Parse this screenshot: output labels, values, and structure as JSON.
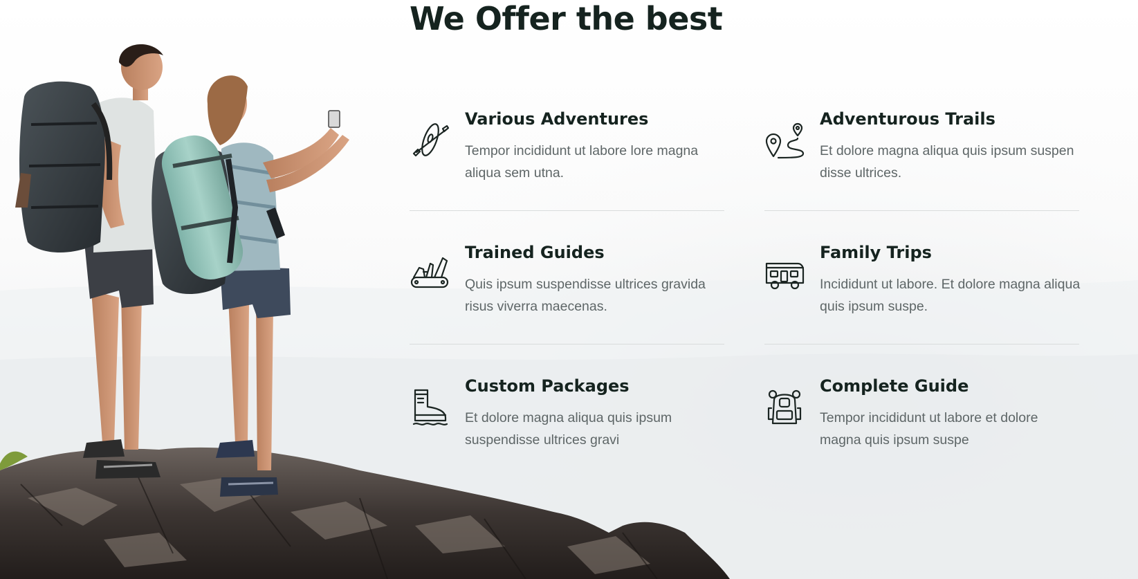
{
  "section": {
    "heading": "We Offer the best"
  },
  "features": [
    {
      "title": "Various Adventures",
      "description": "Tempor incididunt ut labore lore magna aliqua sem utna.",
      "icon": "kayak-icon"
    },
    {
      "title": "Adventurous Trails",
      "description": "Et dolore magna aliqua quis ipsum suspen disse ultrices.",
      "icon": "trail-route-icon"
    },
    {
      "title": "Trained Guides",
      "description": "Quis ipsum suspendisse ultrices gravida risus viverra maecenas.",
      "icon": "multitool-knife-icon"
    },
    {
      "title": "Family Trips",
      "description": "Incididunt ut labore. Et dolore magna aliqua quis ipsum suspe.",
      "icon": "camper-van-icon"
    },
    {
      "title": "Custom Packages",
      "description": "Et dolore magna aliqua quis ipsum suspendisse ultrices gravi",
      "icon": "hiking-boot-icon"
    },
    {
      "title": "Complete Guide",
      "description": "Tempor incididunt ut labore et dolore magna quis ipsum suspe",
      "icon": "backpack-icon"
    }
  ],
  "colors": {
    "heading": "#15231f",
    "body_text": "#5e6667",
    "divider": "#d9dcdc",
    "icon": "#1b2522"
  }
}
